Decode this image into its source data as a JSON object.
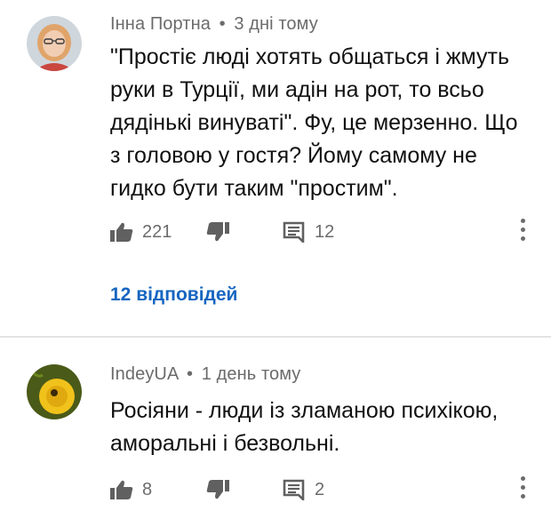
{
  "comments": [
    {
      "author": "Інна Портна",
      "separator": "•",
      "time": "3 дні тому",
      "text": "\"Простіє люді хотять общаться і жмуть руки в Турції, ми адін на рот, то всьо дядінькі винуваті\". Фу, це мерзенно. Що з головою у гостя? Йому самому не гидко бути таким \"простим\".",
      "likes": "221",
      "replies_count": "12",
      "replies_link": "12 відповідей",
      "avatar_icon": "person-avatar",
      "colors": {
        "avatar_bg": "#cfd6dc",
        "hair": "#e0a46a",
        "skin": "#f1cdb3",
        "shirt": "#c9473f"
      }
    },
    {
      "author": "IndeyUA",
      "separator": "•",
      "time": "1 день тому",
      "text": "Росіяни - люди із зламаною психікою, аморальні і безвольні.",
      "likes": "8",
      "replies_count": "2",
      "avatar_icon": "dandelion-avatar",
      "colors": {
        "avatar_bg": "#4a5a18",
        "flower": "#f1c21b"
      }
    }
  ],
  "icons": {
    "like": "thumbs-up-icon",
    "dislike": "thumbs-down-icon",
    "reply": "reply-comment-icon",
    "more": "more-vert-icon"
  },
  "colors": {
    "meta_text": "#6b6b6b",
    "link": "#1565c0",
    "divider": "#e3e3e3"
  }
}
